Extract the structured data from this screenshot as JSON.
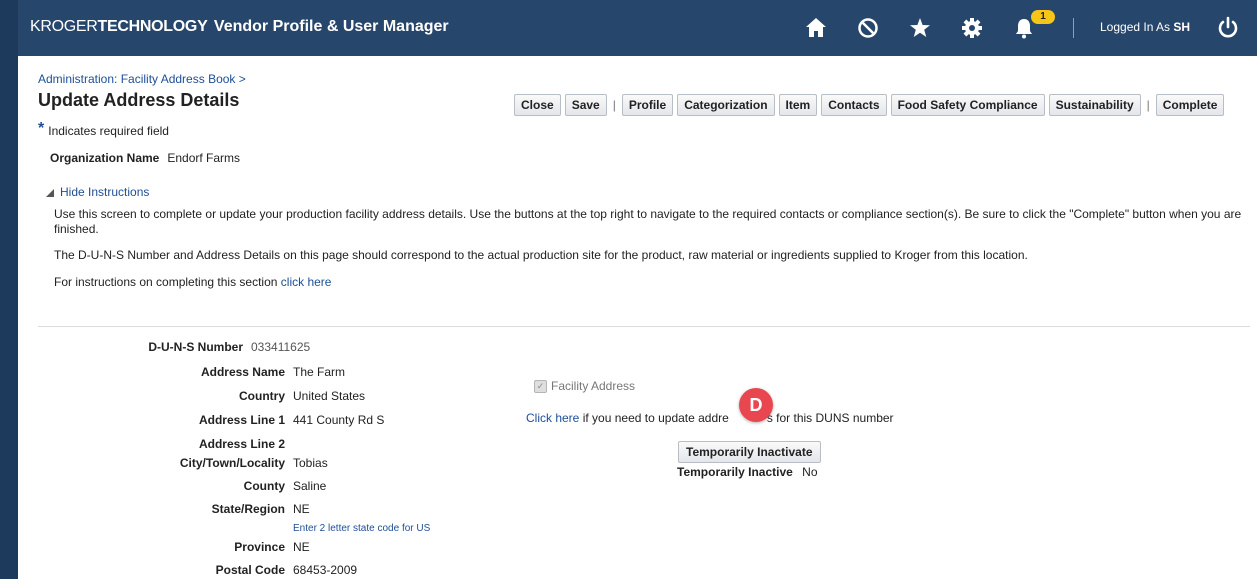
{
  "header": {
    "brand_part1": "KROGER",
    "brand_part2": "TECHNOLOGY",
    "app_title": "Vendor Profile & User Manager",
    "notification_count": "1",
    "logged_in_label": "Logged In As",
    "logged_in_user": "SH",
    "icons": [
      "home-icon",
      "no-entry-icon",
      "star-icon",
      "gear-icon",
      "bell-icon",
      "power-icon"
    ]
  },
  "breadcrumb": "Administration: Facility Address Book >",
  "page_title": "Update Address Details",
  "toolbar": {
    "close": "Close",
    "save": "Save",
    "profile": "Profile",
    "categorization": "Categorization",
    "item": "Item",
    "contacts": "Contacts",
    "food_safety": "Food Safety Compliance",
    "sustainability": "Sustainability",
    "complete": "Complete",
    "separator": "|"
  },
  "required_note": "Indicates required field",
  "required_star": "*",
  "organization": {
    "label": "Organization Name",
    "value": "Endorf Farms"
  },
  "instructions": {
    "toggle": "Hide Instructions",
    "para1": "Use this screen to complete or update your production facility address details. Use the buttons at the top right to navigate to the required contacts or compliance section(s). Be sure to click the \"Complete\" button when you are finished.",
    "para2": "The D-U-N-S Number and Address Details on this page should correspond to the actual production site for the product, raw material or ingredients supplied to Kroger from this location.",
    "para3_prefix": "For instructions on completing this section",
    "para3_link": "click here"
  },
  "form": {
    "duns_label": "D-U-N-S Number",
    "duns_value": "033411625",
    "address_name_label": "Address Name",
    "address_name_value": "The Farm",
    "country_label": "Country",
    "country_value": "United States",
    "address1_label": "Address Line 1",
    "address1_value": "441 County Rd S",
    "address2_label": "Address Line 2",
    "city_label": "City/Town/Locality",
    "city_value": "Tobias",
    "county_label": "County",
    "county_value": "Saline",
    "state_label": "State/Region",
    "state_value": "NE",
    "state_hint": "Enter 2 letter state code for US",
    "province_label": "Province",
    "province_value": "NE",
    "postal_label": "Postal Code",
    "postal_value": "68453-2009"
  },
  "facility": {
    "checkbox_label": "Facility Address",
    "update_link": "Click here",
    "update_text_a": "if you need to update addre",
    "update_text_b": "s for this DUNS number",
    "inactivate_button": "Temporarily Inactivate",
    "inactive_label": "Temporarily Inactive",
    "inactive_value": "No"
  },
  "marker_label": "D"
}
